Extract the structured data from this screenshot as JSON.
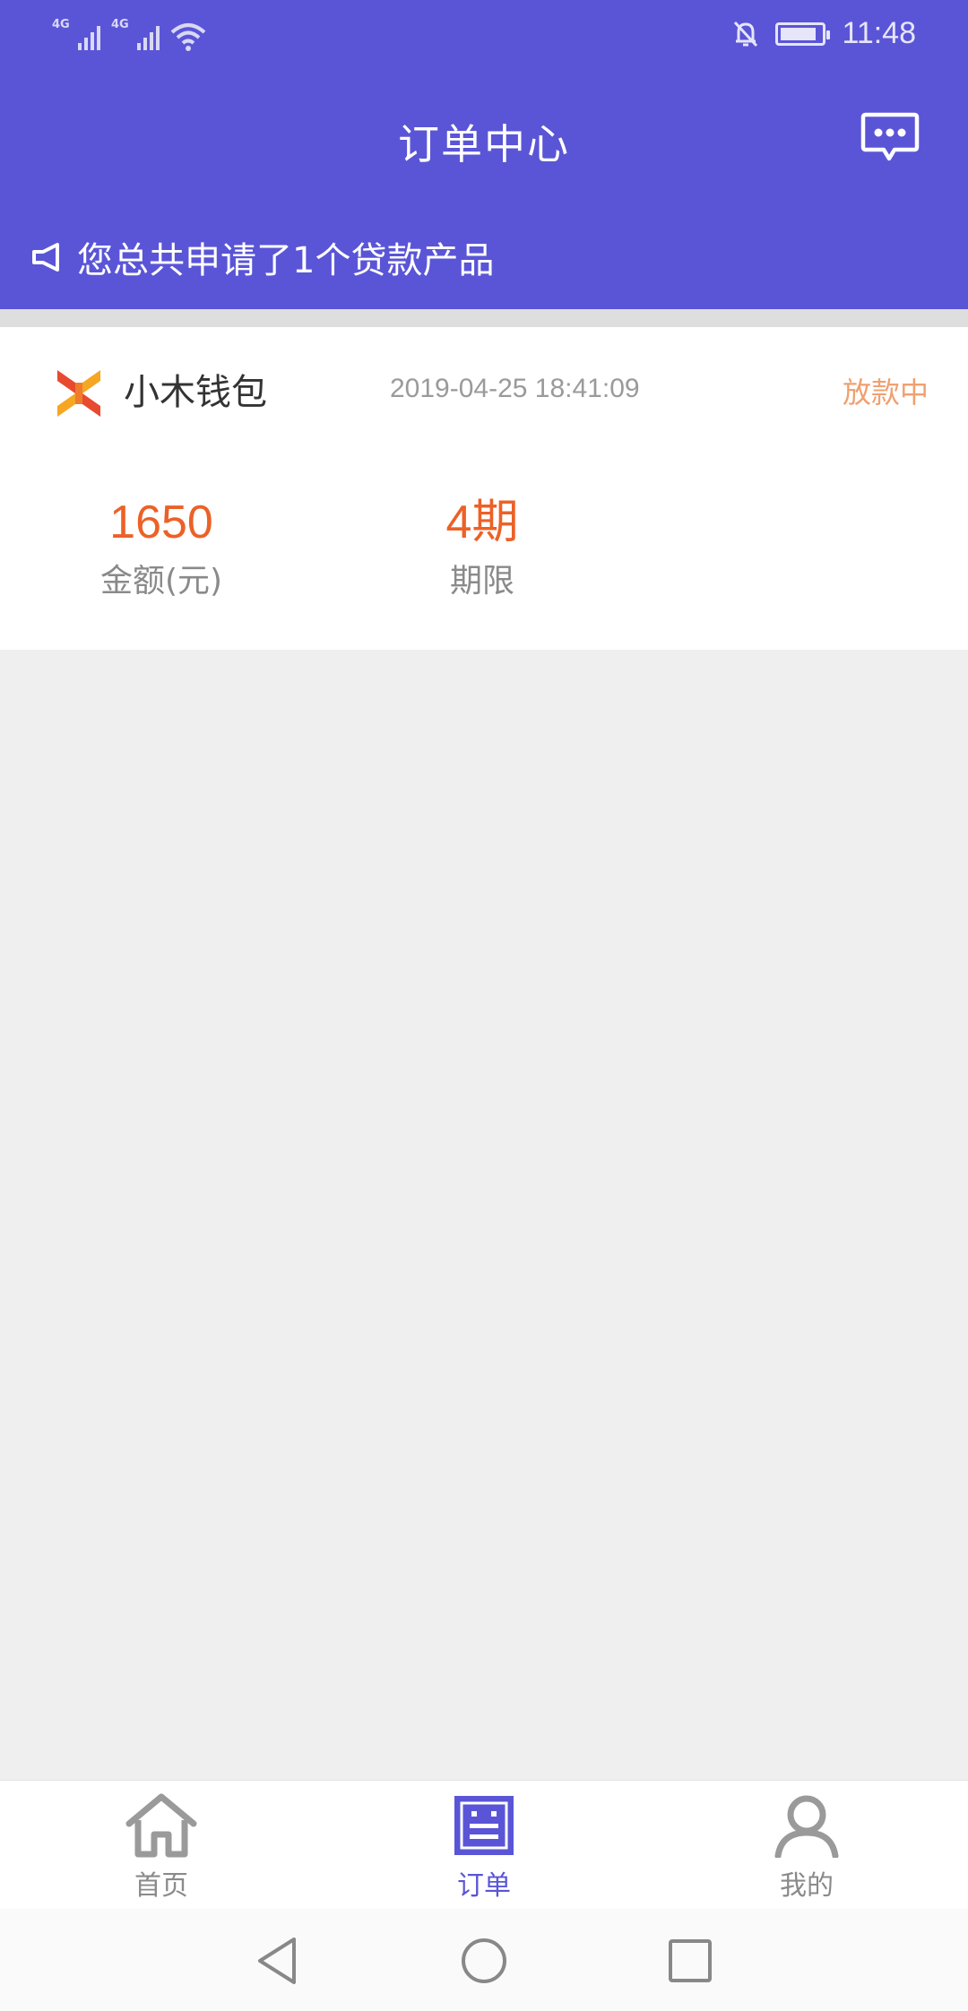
{
  "status_bar": {
    "network1": "4G",
    "network2": "4G",
    "time": "11:48",
    "battery_level": 0.9
  },
  "header": {
    "title": "订单中心",
    "message_icon": "chat-bubble-icon",
    "notice_icon": "megaphone-icon",
    "notice_text": "您总共申请了1个贷款产品"
  },
  "order": {
    "product_name": "小木钱包",
    "logo_icon": "xiaomu-logo-icon",
    "time": "2019-04-25 18:41:09",
    "status": "放款中",
    "amount_value": "1650",
    "amount_label": "金额(元)",
    "term_value": "4期",
    "term_label": "期限"
  },
  "tabs": [
    {
      "label": "首页",
      "icon": "home-icon",
      "active": false
    },
    {
      "label": "订单",
      "icon": "order-icon",
      "active": true
    },
    {
      "label": "我的",
      "icon": "user-icon",
      "active": false
    }
  ],
  "colors": {
    "primary": "#5a55d6",
    "accent": "#ec6127",
    "status": "#f0a070",
    "inactive": "#8a8a8a"
  }
}
